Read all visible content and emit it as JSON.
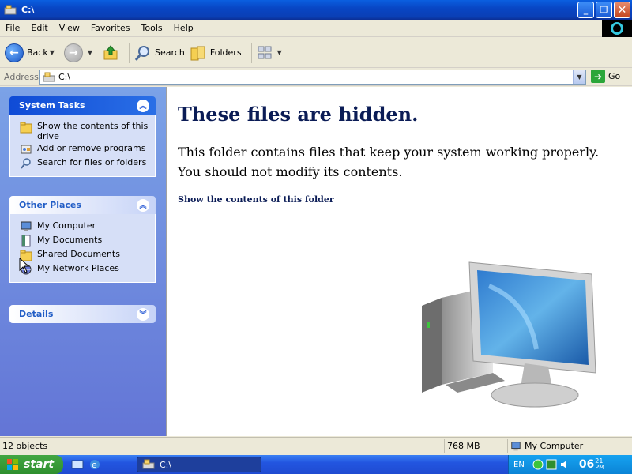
{
  "window": {
    "title": "C:\\",
    "buttons": [
      "minimize",
      "maximize",
      "close"
    ]
  },
  "menu": [
    "File",
    "Edit",
    "View",
    "Favorites",
    "Tools",
    "Help"
  ],
  "toolbar": {
    "back_label": "Back",
    "search_label": "Search",
    "folders_label": "Folders"
  },
  "address": {
    "label": "Address",
    "value": "C:\\",
    "go_label": "Go"
  },
  "left_pane": {
    "system_tasks": {
      "title": "System Tasks",
      "items": [
        {
          "label": "Show the contents of this drive",
          "icon": "folder-icon"
        },
        {
          "label": "Add or remove programs",
          "icon": "programs-icon"
        },
        {
          "label": "Search for files or folders",
          "icon": "search-icon"
        }
      ]
    },
    "other_places": {
      "title": "Other Places",
      "items": [
        {
          "label": "My Computer",
          "icon": "computer-icon"
        },
        {
          "label": "My Documents",
          "icon": "documents-icon"
        },
        {
          "label": "Shared Documents",
          "icon": "folder-icon"
        },
        {
          "label": "My Network Places",
          "icon": "network-icon"
        }
      ]
    },
    "details": {
      "title": "Details"
    }
  },
  "main": {
    "heading": "These files are hidden.",
    "description": "This folder contains files that keep your system working properly. You should not modify its contents.",
    "link": "Show the contents of this folder"
  },
  "status": {
    "objects": "12 objects",
    "size": "768 MB",
    "location": "My Computer"
  },
  "taskbar": {
    "start_label": "start",
    "window_label": "C:\\",
    "language": "EN",
    "clock_hour": "06",
    "clock_minute": "21",
    "clock_ampm": "PM"
  },
  "colors": {
    "heading": "#0b1c56",
    "titlebar": "#0a4fd0",
    "left_pane": "#7ba2e7",
    "taskbar": "#2255e0",
    "start": "#3a9c3a"
  }
}
